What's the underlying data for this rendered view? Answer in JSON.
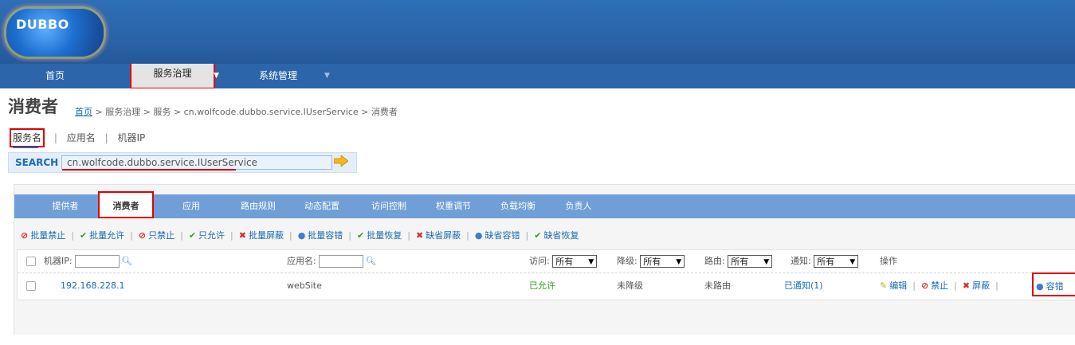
{
  "header": {
    "logo_text": "DUBBO"
  },
  "nav": {
    "home": "首页",
    "service": "服务治理",
    "system": "系统管理"
  },
  "page": {
    "title": "消费者",
    "breadcrumb": {
      "home": "首页",
      "rest": " > 服务治理 > 服务 > cn.wolfcode.dubbo.service.IUserService > 消费者"
    }
  },
  "filters": {
    "service_name": "服务名",
    "app_name": "应用名",
    "machine_ip": "机器IP"
  },
  "search": {
    "label": "SEARCH",
    "value": "cn.wolfcode.dubbo.service.IUserService"
  },
  "tabs": [
    "提供者",
    "消费者",
    "应用",
    "路由规则",
    "动态配置",
    "访问控制",
    "权重调节",
    "负载均衡",
    "负责人"
  ],
  "actions": [
    "批量禁止",
    "批量允许",
    "只禁止",
    "只允许",
    "批量屏蔽",
    "批量容错",
    "批量恢复",
    "缺省屏蔽",
    "缺省容错",
    "缺省恢复"
  ],
  "table": {
    "headers": {
      "machine_ip": "机器IP:",
      "app_name": "应用名:",
      "access": "访问:",
      "degrade": "降级:",
      "route": "路由:",
      "notify": "通知:",
      "ops": "操作"
    },
    "select_all": "所有",
    "rows": [
      {
        "ip": "192.168.228.1",
        "app": "webSite",
        "access": "已允许",
        "degrade": "未降级",
        "route": "未路由",
        "notify": "已通知(1)",
        "ops": [
          "编辑",
          "禁止",
          "屏蔽",
          "容错"
        ]
      }
    ]
  },
  "colors": {
    "header": "#2a64a8",
    "tab_bar": "#6f9fd6",
    "link": "#1a6bb8",
    "highlight": "#e00000"
  }
}
